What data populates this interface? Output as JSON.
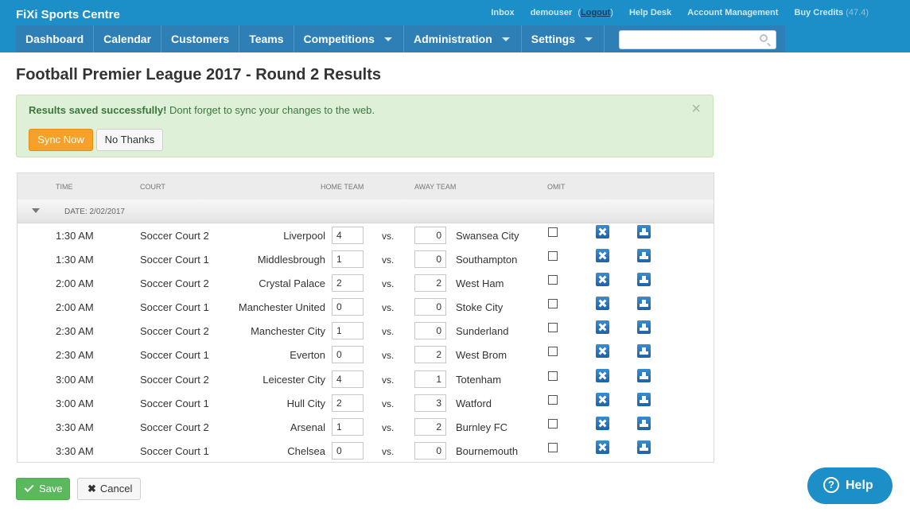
{
  "header": {
    "brand": "FiXi Sports Centre",
    "links": {
      "inbox": "Inbox",
      "user": "demouser",
      "logout_open": "(",
      "logout": "Logout",
      "logout_close": ")",
      "help": "Help Desk",
      "account": "Account Management",
      "buy": "Buy Credits",
      "credits": "(47.4)"
    }
  },
  "nav": {
    "items": [
      {
        "label": "Dashboard"
      },
      {
        "label": "Calendar"
      },
      {
        "label": "Customers"
      },
      {
        "label": "Teams"
      },
      {
        "label": "Competitions"
      },
      {
        "label": "Administration"
      },
      {
        "label": "Settings"
      }
    ],
    "search_placeholder": ""
  },
  "page": {
    "title": "Football Premier League 2017 - Round 2 Results"
  },
  "alert": {
    "strong": "Results saved successfully!",
    "text": " Dont forget to sync your changes to the web.",
    "close": "×",
    "sync": "Sync Now",
    "no_thanks": "No Thanks"
  },
  "table": {
    "headers": {
      "time": "Time",
      "court": "Court",
      "home": "Home Team",
      "away": "Away Team",
      "omit": "Omit"
    },
    "group_label": "DATE: 2/02/2017",
    "vs": "vs.",
    "rows": [
      {
        "time": "1:30 AM",
        "court": "Soccer Court 2",
        "home": "Liverpool",
        "home_score": "4",
        "away_score": "0",
        "away": "Swansea City"
      },
      {
        "time": "1:30 AM",
        "court": "Soccer Court 1",
        "home": "Middlesbrough",
        "home_score": "1",
        "away_score": "0",
        "away": "Southampton"
      },
      {
        "time": "2:00 AM",
        "court": "Soccer Court 2",
        "home": "Crystal Palace",
        "home_score": "2",
        "away_score": "2",
        "away": "West Ham"
      },
      {
        "time": "2:00 AM",
        "court": "Soccer Court 1",
        "home": "Manchester United",
        "home_score": "0",
        "away_score": "0",
        "away": "Stoke City"
      },
      {
        "time": "2:30 AM",
        "court": "Soccer Court 2",
        "home": "Manchester City",
        "home_score": "1",
        "away_score": "0",
        "away": "Sunderland"
      },
      {
        "time": "2:30 AM",
        "court": "Soccer Court 1",
        "home": "Everton",
        "home_score": "0",
        "away_score": "2",
        "away": "West Brom"
      },
      {
        "time": "3:00 AM",
        "court": "Soccer Court 2",
        "home": "Leicester City",
        "home_score": "4",
        "away_score": "1",
        "away": "Totenham"
      },
      {
        "time": "3:00 AM",
        "court": "Soccer Court 1",
        "home": "Hull City",
        "home_score": "2",
        "away_score": "3",
        "away": "Watford"
      },
      {
        "time": "3:30 AM",
        "court": "Soccer Court 2",
        "home": "Arsenal",
        "home_score": "1",
        "away_score": "2",
        "away": "Burnley FC"
      },
      {
        "time": "3:30 AM",
        "court": "Soccer Court 1",
        "home": "Chelsea",
        "home_score": "0",
        "away_score": "0",
        "away": "Bournemouth"
      }
    ]
  },
  "footer": {
    "save": "Save",
    "cancel": "Cancel",
    "help": "Help"
  }
}
